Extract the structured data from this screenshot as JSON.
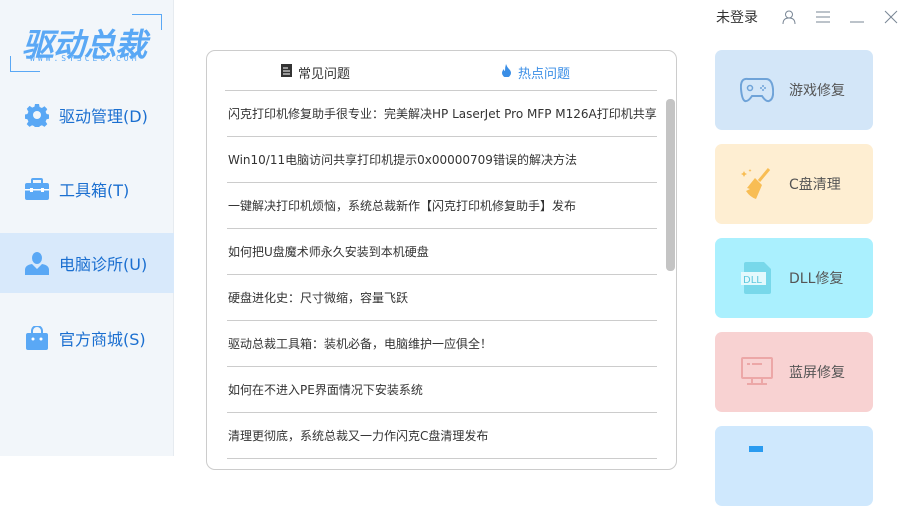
{
  "logo": {
    "text": "驱动总裁",
    "url": "WWW.SYSCEO.COM"
  },
  "topbar": {
    "login": "未登录",
    "icons": [
      "user-icon",
      "menu-icon",
      "minimize-icon",
      "close-icon"
    ]
  },
  "sidebar": {
    "items": [
      {
        "label": "驱动管理(D)",
        "icon": "gear-icon"
      },
      {
        "label": "工具箱(T)",
        "icon": "toolbox-icon"
      },
      {
        "label": "电脑诊所(U)",
        "icon": "person-icon",
        "active": true
      },
      {
        "label": "官方商城(S)",
        "icon": "shopping-bag-icon"
      }
    ]
  },
  "panel": {
    "tabs": [
      {
        "label": "常见问题",
        "icon": "document-icon"
      },
      {
        "label": "热点问题",
        "icon": "flame-icon",
        "active": true
      }
    ],
    "items": [
      "闪克打印机修复助手很专业：完美解决HP LaserJet Pro MFP M126A打印机共享",
      "Win10/11电脑访问共享打印机提示0x00000709错误的解决方法",
      "一键解决打印机烦恼，系统总裁新作【闪克打印机修复助手】发布",
      "如何把U盘魔术师永久安装到本机硬盘",
      "硬盘进化史：尺寸微缩，容量飞跃",
      "驱动总裁工具箱：装机必备，电脑维护一应俱全！",
      "如何在不进入PE界面情况下安装系统",
      "清理更彻底，系统总裁又一力作闪克C盘清理发布"
    ]
  },
  "cards": [
    {
      "label": "游戏修复",
      "icon": "gamepad-icon",
      "color": "#d3e6f8"
    },
    {
      "label": "C盘清理",
      "icon": "broom-icon",
      "color": "#feeed2"
    },
    {
      "label": "DLL修复",
      "icon": "dll-file-icon",
      "color": "#aaf0fe"
    },
    {
      "label": "蓝屏修复",
      "icon": "monitor-icon",
      "color": "#f8d2d2"
    },
    {
      "label": "",
      "icon": "tool-icon",
      "color": "#cfe8fd"
    }
  ],
  "accent": "#1b6fd0"
}
